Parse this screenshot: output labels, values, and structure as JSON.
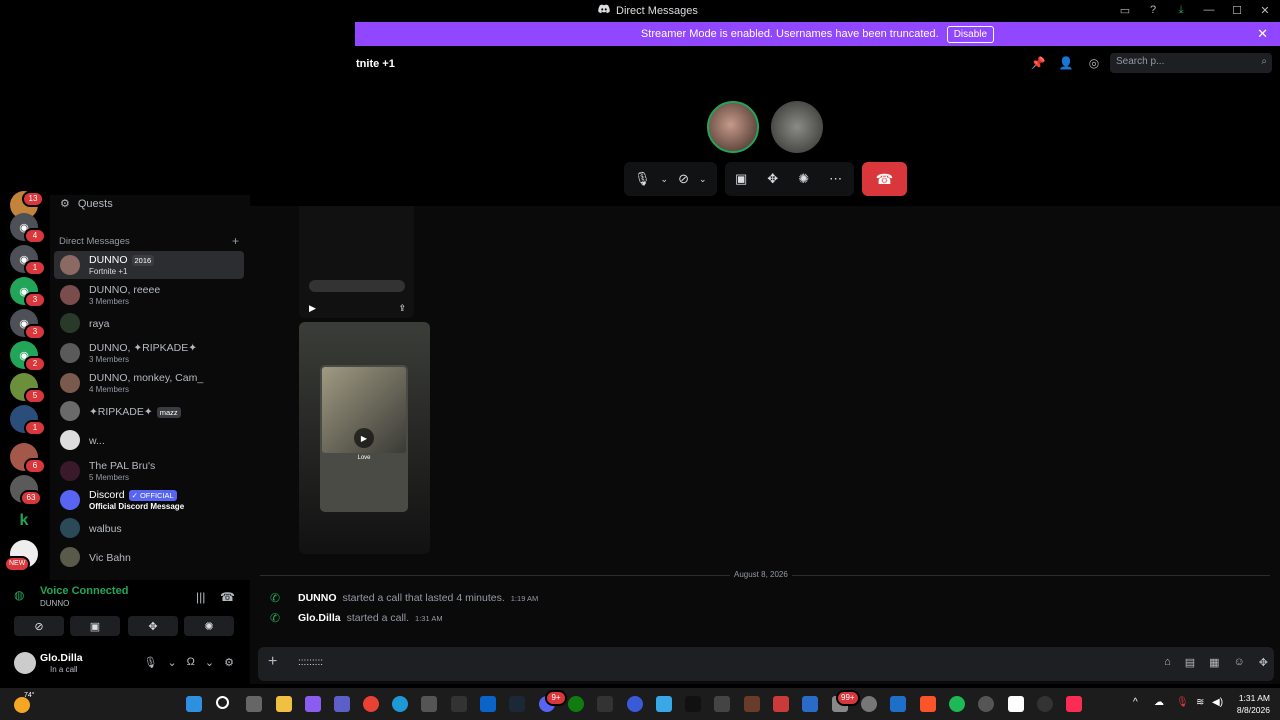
{
  "window": {
    "title": "Direct Messages"
  },
  "banner": {
    "text": "Streamer Mode is enabled. Usernames have been truncated.",
    "button": "Disable"
  },
  "call": {
    "title": "tnite +1",
    "search_placeholder": "Search p..."
  },
  "quests_label": "Quests",
  "dm_header": "Direct Messages",
  "servers": [
    {
      "badge": "13"
    },
    {
      "badge": "4"
    },
    {
      "badge": "1"
    },
    {
      "badge": "3"
    },
    {
      "badge": "3"
    },
    {
      "badge": "2"
    },
    {
      "badge": "5"
    },
    {
      "badge": "1"
    },
    {
      "badge": "6"
    },
    {
      "badge": "63"
    },
    {
      "badge": ""
    },
    {
      "badge": "NEW"
    }
  ],
  "dms": [
    {
      "name": "DUNNO",
      "tag": "2016",
      "sub": "Fortnite +1"
    },
    {
      "name": "DUNNO, reeee",
      "sub": "3 Members"
    },
    {
      "name": "raya",
      "sub": ""
    },
    {
      "name": "DUNNO, ✦RIPKADE✦",
      "sub": "3 Members"
    },
    {
      "name": "DUNNO, monkey, Cam_",
      "sub": "4 Members"
    },
    {
      "name": "✦RIPKADE✦",
      "tag": "mazz",
      "sub": ""
    },
    {
      "name": "w...",
      "sub": ""
    },
    {
      "name": "The PAL Bru's",
      "sub": "5 Members"
    },
    {
      "name": "Discord",
      "tag": "✓ OFFICIAL",
      "sub": "Official Discord Message"
    },
    {
      "name": "walbus",
      "sub": ""
    },
    {
      "name": "Vic Bahn",
      "sub": ""
    }
  ],
  "media_card": {
    "title": "Love"
  },
  "date_separator": "August 8, 2026",
  "messages": [
    {
      "user": "DUNNO",
      "text": "started a call that lasted 4 minutes.",
      "time": "1:19 AM"
    },
    {
      "user": "Glo.Dilla",
      "text": "started a call.",
      "time": "1:31 AM"
    }
  ],
  "composer": {
    "text": ":::::::::"
  },
  "voice": {
    "status": "Voice Connected",
    "channel": "DUNNO"
  },
  "user": {
    "name": "Glo.Dilla",
    "status": "In a call"
  },
  "taskbar": {
    "temperature": "74°",
    "time": "1:31 AM",
    "date": "8/8/2026",
    "badges": [
      "9+",
      "99+"
    ]
  },
  "colors": {
    "accent": "#5865f2",
    "banner": "#9146ff",
    "danger": "#da373c",
    "online": "#23a559"
  }
}
